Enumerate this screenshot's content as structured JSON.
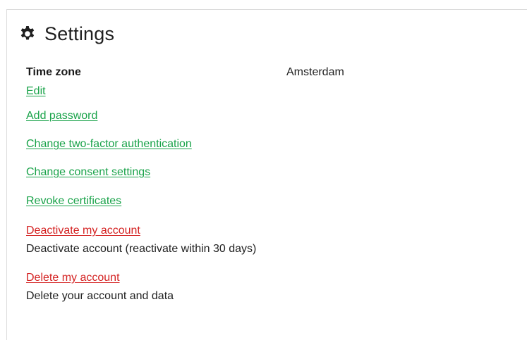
{
  "settings": {
    "title": "Settings",
    "icon": "gear-icon",
    "time_zone": {
      "label": "Time zone",
      "value": "Amsterdam",
      "edit_label": "Edit"
    },
    "links": {
      "add_password": "Add password",
      "change_2fa": "Change two-factor authentication",
      "change_consent": "Change consent settings",
      "revoke_certificates": "Revoke certificates"
    },
    "danger": {
      "deactivate_label": "Deactivate my account",
      "deactivate_desc": "Deactivate account (reactivate within 30 days)",
      "delete_label": "Delete my account",
      "delete_desc": "Delete your account and data"
    },
    "colors": {
      "link_green": "#1aa34a",
      "link_red": "#d42222"
    }
  }
}
